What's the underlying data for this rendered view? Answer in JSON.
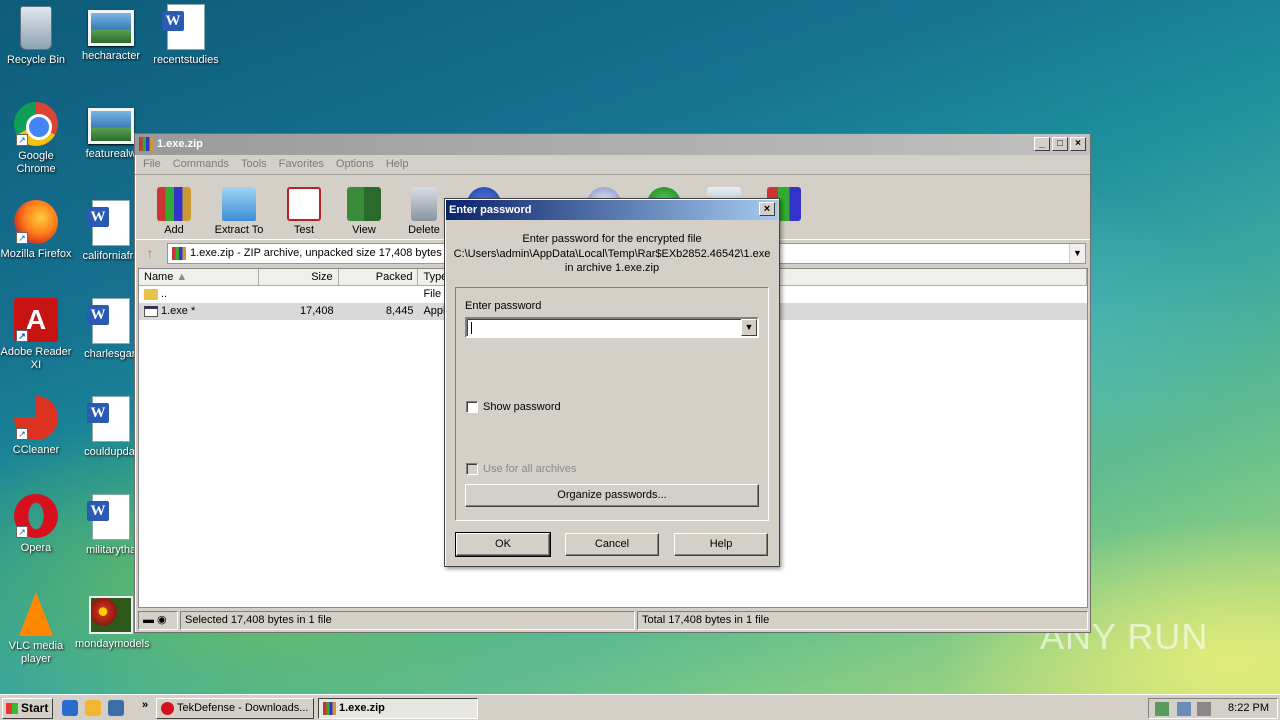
{
  "desktop": {
    "icons": [
      {
        "label": "Recycle Bin"
      },
      {
        "label": "hecharacter"
      },
      {
        "label": "recentstudies"
      },
      {
        "label": "Google Chrome"
      },
      {
        "label": "featurealw"
      },
      {
        "label": "Mozilla Firefox"
      },
      {
        "label": "californiafra"
      },
      {
        "label": "Adobe Reader XI"
      },
      {
        "label": "charlesgan"
      },
      {
        "label": "CCleaner"
      },
      {
        "label": "couldupdat"
      },
      {
        "label": "Opera"
      },
      {
        "label": "militarytha"
      },
      {
        "label": "VLC media player"
      },
      {
        "label": "mondaymodels"
      }
    ],
    "watermark": "ANY RUN"
  },
  "window": {
    "title": "1.exe.zip",
    "menu": [
      "File",
      "Commands",
      "Tools",
      "Favorites",
      "Options",
      "Help"
    ],
    "toolbar": [
      "Add",
      "Extract To",
      "Test",
      "View",
      "Delete"
    ],
    "address": "1.exe.zip - ZIP archive, unpacked size 17,408 bytes",
    "columns": {
      "name": "Name",
      "size": "Size",
      "packed": "Packed",
      "type": "Type"
    },
    "rows": [
      {
        "name": "..",
        "size": "",
        "packed": "",
        "type": "File folder"
      },
      {
        "name": "1.exe *",
        "size": "17,408",
        "packed": "8,445",
        "type": "Application"
      }
    ],
    "status_left": "Selected 17,408 bytes in 1 file",
    "status_right": "Total 17,408 bytes in 1 file"
  },
  "dialog": {
    "title": "Enter password",
    "info_line1": "Enter password for the encrypted file",
    "info_line2": "C:\\Users\\admin\\AppData\\Local\\Temp\\Rar$EXb2852.46542\\1.exe",
    "info_line3": "in archive 1.exe.zip",
    "password_label": "Enter password",
    "password_value": "",
    "show_password": "Show password",
    "use_for_all": "Use for all archives",
    "organize": "Organize passwords...",
    "ok": "OK",
    "cancel": "Cancel",
    "help": "Help"
  },
  "taskbar": {
    "start": "Start",
    "tasks": [
      {
        "label": "TekDefense - Downloads..."
      },
      {
        "label": "1.exe.zip"
      }
    ],
    "clock": "8:22 PM"
  }
}
